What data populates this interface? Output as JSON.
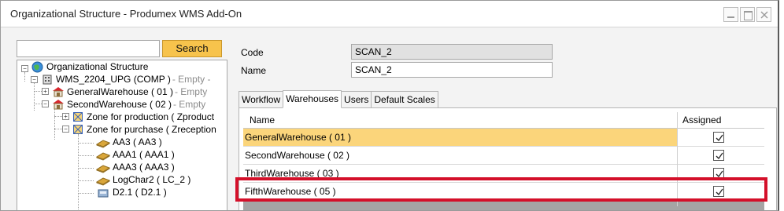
{
  "window": {
    "title": "Organizational Structure - Produmex WMS Add-On"
  },
  "search": {
    "placeholder": "",
    "value": "",
    "button_label": "Search"
  },
  "tree": {
    "nodes": [
      {
        "label": "Organizational Structure",
        "extra": "",
        "icon": "globe-icon"
      },
      {
        "label": "WMS_2204_UPG (COMP )",
        "extra": "- Empty -",
        "icon": "company-icon"
      },
      {
        "label": "GeneralWarehouse ( 01 )",
        "extra": "- Empty",
        "icon": "warehouse-icon"
      },
      {
        "label": "SecondWarehouse ( 02 )",
        "extra": "- Empty",
        "icon": "warehouse-icon"
      },
      {
        "label": "Zone for production ( Zproduct",
        "extra": "",
        "icon": "zone-icon"
      },
      {
        "label": "Zone for purchase ( Zreception",
        "extra": "",
        "icon": "zone-icon"
      },
      {
        "label": "AA3 ( AA3 )",
        "extra": "",
        "icon": "location-icon"
      },
      {
        "label": "AAA1 ( AAA1 )",
        "extra": "",
        "icon": "location-icon"
      },
      {
        "label": "AAA3 ( AAA3 )",
        "extra": "",
        "icon": "location-icon"
      },
      {
        "label": "LogChar2 ( LC_2 )",
        "extra": "",
        "icon": "location-icon"
      },
      {
        "label": "D2.1 ( D2.1 )",
        "extra": "",
        "icon": "device-icon"
      }
    ]
  },
  "form": {
    "code_label": "Code",
    "code_value": "SCAN_2",
    "name_label": "Name",
    "name_value": "SCAN_2"
  },
  "tabs": [
    "Workflow",
    "Warehouses",
    "Users",
    "Default Scales"
  ],
  "active_tab": "Warehouses",
  "grid": {
    "columns": [
      "Name",
      "Assigned"
    ],
    "rows": [
      {
        "name": "GeneralWarehouse ( 01 )",
        "assigned": true,
        "selected": true
      },
      {
        "name": "SecondWarehouse ( 02 )",
        "assigned": true,
        "selected": false
      },
      {
        "name": "ThirdWarehouse ( 03 )",
        "assigned": true,
        "selected": false
      },
      {
        "name": "FifthWarehouse ( 05 )",
        "assigned": true,
        "selected": false
      }
    ]
  },
  "colors": {
    "search_button": "#f7c34c",
    "selected_row": "#fbd57b",
    "highlight_box": "#d4102a"
  }
}
